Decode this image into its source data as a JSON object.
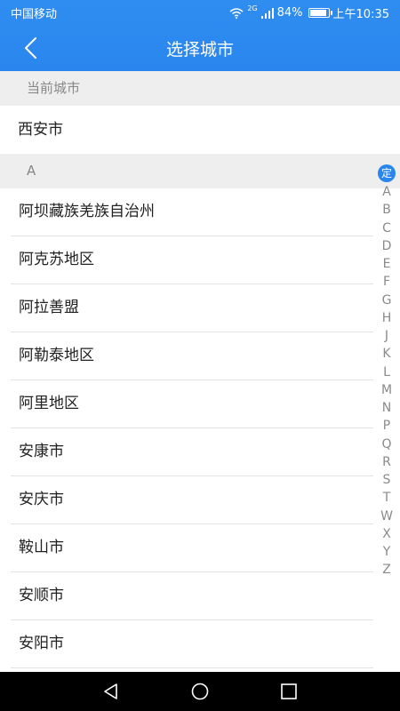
{
  "status": {
    "carrier": "中国移动",
    "network": "2G",
    "battery": "84%",
    "time": "上午10:35"
  },
  "header": {
    "title": "选择城市"
  },
  "current_section": {
    "label": "当前城市",
    "city": "西安市"
  },
  "section_a": {
    "letter": "A",
    "cities": [
      "阿坝藏族羌族自治州",
      "阿克苏地区",
      "阿拉善盟",
      "阿勒泰地区",
      "阿里地区",
      "安康市",
      "安庆市",
      "鞍山市",
      "安顺市",
      "安阳市"
    ]
  },
  "index": {
    "locate": "定",
    "letters": [
      "A",
      "B",
      "C",
      "D",
      "E",
      "F",
      "G",
      "H",
      "J",
      "K",
      "L",
      "M",
      "N",
      "P",
      "Q",
      "R",
      "S",
      "T",
      "W",
      "X",
      "Y",
      "Z"
    ]
  },
  "colors": {
    "accent": "#2a86ee",
    "section_bg": "#eeeeee"
  }
}
